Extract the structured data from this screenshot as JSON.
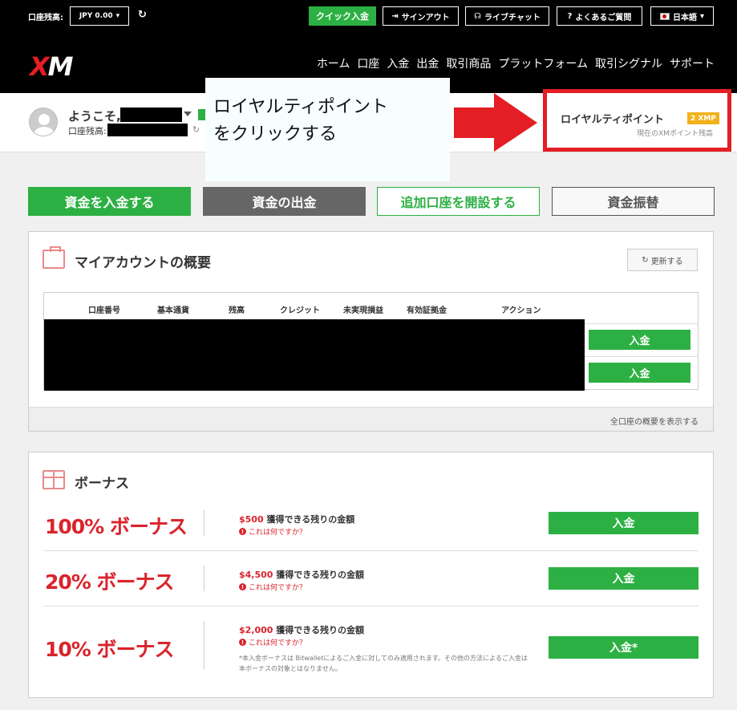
{
  "topbar": {
    "balance_label": "口座残高:",
    "currency_value": "JPY 0.00",
    "quick_deposit": "クイック入金",
    "signout": "サインアウト",
    "live_chat": "ライブチャット",
    "faq": "よくあるご質問",
    "language": "日本語"
  },
  "nav": {
    "logo_x": "X",
    "logo_m": "M",
    "links": [
      "ホーム",
      "口座",
      "入金",
      "出金",
      "取引商品",
      "プラットフォーム",
      "取引シグナル",
      "サポート"
    ]
  },
  "user": {
    "welcome": "ようこそ,",
    "balance_label": "口座残高:"
  },
  "callout": {
    "line1": "ロイヤルティポイント",
    "line2": "をクリックする"
  },
  "loyalty": {
    "title": "ロイヤルティポイント",
    "badge": "2 XMP",
    "subtitle": "現在のXMポイント残高"
  },
  "actions": {
    "deposit": "資金を入金する",
    "withdraw": "資金の出金",
    "open_account": "追加口座を開設する",
    "transfer": "資金振替"
  },
  "account_overview": {
    "title": "マイアカウントの概要",
    "refresh": "更新する",
    "columns": [
      "口座番号",
      "基本通貨",
      "残高",
      "クレジット",
      "未実現損益",
      "有効証拠金",
      "アクション"
    ],
    "row_buttons": [
      "入金",
      "入金"
    ],
    "show_all": "全口座の概要を表示する"
  },
  "bonus": {
    "title": "ボーナス",
    "items": [
      {
        "pct": "100% ボーナス",
        "amount": "$500",
        "desc": " 獲得できる残りの金額",
        "help": "これは何ですか？",
        "button": "入金"
      },
      {
        "pct": "20% ボーナス",
        "amount": "$4,500",
        "desc": " 獲得できる残りの金額",
        "help": "これは何ですか？",
        "button": "入金"
      },
      {
        "pct": "10% ボーナス",
        "amount": "$2,000",
        "desc": " 獲得できる残りの金額",
        "help": "これは何ですか？",
        "button": "入金*"
      }
    ],
    "note": "*本入金ボーナスは Bitwalletによるご入金に対してのみ適用されます。その他の方法によるご入金は本ボーナスの対象とはなりません。"
  },
  "colors": {
    "green": "#2db043",
    "red": "#e31e24",
    "gold": "#f2b11b"
  }
}
